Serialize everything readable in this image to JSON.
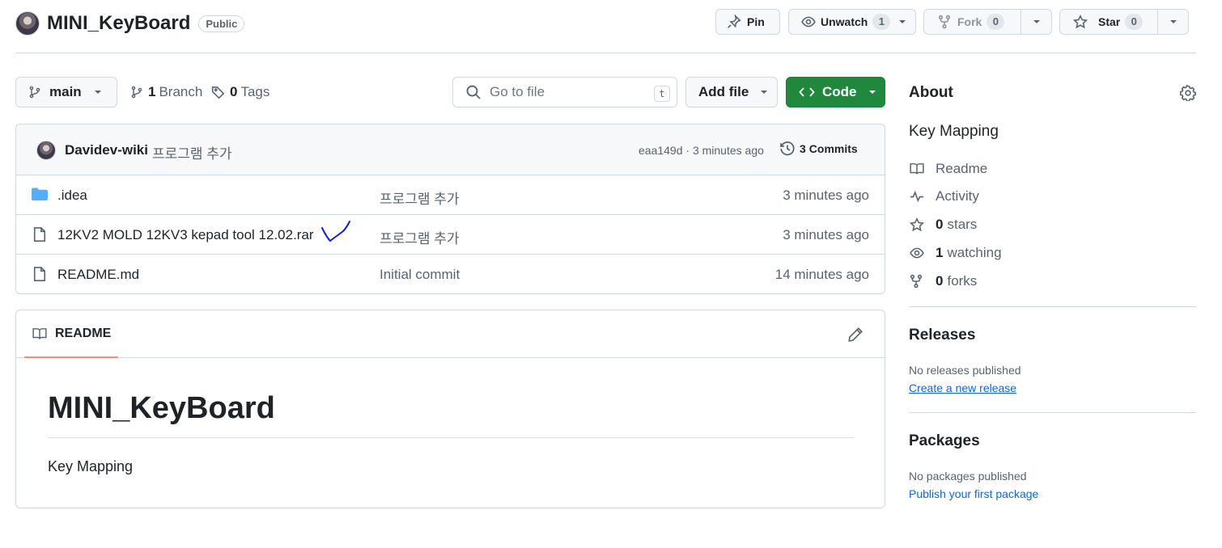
{
  "repo": {
    "name": "MINI_KeyBoard",
    "visibility": "Public"
  },
  "header_actions": {
    "pin_label": "Pin",
    "unwatch_label": "Unwatch",
    "unwatch_count": "1",
    "fork_label": "Fork",
    "fork_count": "0",
    "star_label": "Star",
    "star_count": "0"
  },
  "toolbar": {
    "branch": "main",
    "branches_count": "1",
    "branches_label": "Branch",
    "tags_count": "0",
    "tags_label": "Tags",
    "search_placeholder": "Go to file",
    "search_shortcut": "t",
    "add_file_label": "Add file",
    "code_label": "Code"
  },
  "latest_commit": {
    "author": "Davidev-wiki",
    "message": "프로그램 추가",
    "hash_age": "eaa149d · 3 minutes ago",
    "commits_count": "3",
    "commits_label": "Commits"
  },
  "files": [
    {
      "name": ".idea",
      "type": "folder",
      "message": "프로그램 추가",
      "age": "3 minutes ago"
    },
    {
      "name": "12KV2 MOLD 12KV3 kepad tool 12.02.rar",
      "type": "file",
      "message": "프로그램 추가",
      "age": "3 minutes ago"
    },
    {
      "name": "README.md",
      "type": "file",
      "message": "Initial commit",
      "age": "14 minutes ago"
    }
  ],
  "readme": {
    "tab_label": "README",
    "heading": "MINI_KeyBoard",
    "body": "Key Mapping"
  },
  "about": {
    "title": "About",
    "description": "Key Mapping",
    "readme_label": "Readme",
    "activity_label": "Activity",
    "stars_count": "0",
    "stars_label": "stars",
    "watching_count": "1",
    "watching_label": "watching",
    "forks_count": "0",
    "forks_label": "forks"
  },
  "releases": {
    "title": "Releases",
    "empty_text": "No releases published",
    "create_link": "Create a new release"
  },
  "packages": {
    "title": "Packages",
    "empty_text": "No packages published",
    "publish_link": "Publish your first package"
  },
  "colors": {
    "code_button": "#1f883d",
    "link": "#0969da",
    "folder_icon": "#54aeff",
    "active_tab_underline": "#fd8c73",
    "annotation_ink": "#0a1fd6"
  }
}
